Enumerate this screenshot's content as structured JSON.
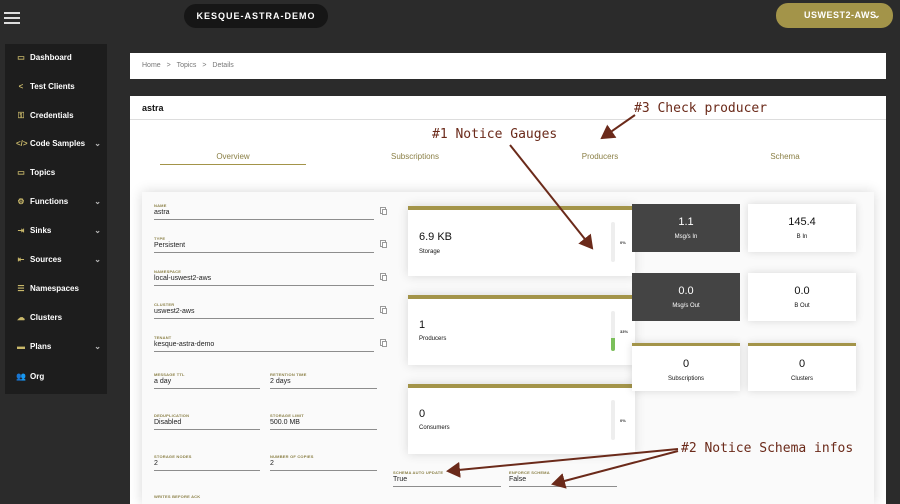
{
  "header": {
    "cluster_name": "KESQUE-ASTRA-DEMO",
    "region": "USWEST2-AWS"
  },
  "sidebar": {
    "items": [
      {
        "label": "Dashboard",
        "icon": "monitor-icon",
        "glyph": "▭",
        "has_chevron": false
      },
      {
        "label": "Test Clients",
        "icon": "share-icon",
        "glyph": "<",
        "has_chevron": false
      },
      {
        "label": "Credentials",
        "icon": "key-icon",
        "glyph": "⚿",
        "has_chevron": false
      },
      {
        "label": "Code Samples",
        "icon": "code-icon",
        "glyph": "</>",
        "has_chevron": true
      },
      {
        "label": "Topics",
        "icon": "folder-icon",
        "glyph": "▭",
        "has_chevron": false
      },
      {
        "label": "Functions",
        "icon": "cogs-icon",
        "glyph": "⚙",
        "has_chevron": true
      },
      {
        "label": "Sinks",
        "icon": "sign-in-icon",
        "glyph": "⇥",
        "has_chevron": true
      },
      {
        "label": "Sources",
        "icon": "sign-out-icon",
        "glyph": "⇤",
        "has_chevron": true
      },
      {
        "label": "Namespaces",
        "icon": "list-icon",
        "glyph": "☰",
        "has_chevron": false
      },
      {
        "label": "Clusters",
        "icon": "cloud-icon",
        "glyph": "☁",
        "has_chevron": false
      },
      {
        "label": "Plans",
        "icon": "card-icon",
        "glyph": "▬",
        "has_chevron": true
      },
      {
        "label": "Org",
        "icon": "users-icon",
        "glyph": "👥",
        "has_chevron": false
      }
    ]
  },
  "breadcrumb": {
    "home": "Home",
    "topics": "Topics",
    "details": "Details",
    "separator": ">"
  },
  "topic": {
    "title": "astra"
  },
  "tabs": [
    {
      "label": "Overview",
      "active": true
    },
    {
      "label": "Subscriptions",
      "active": false
    },
    {
      "label": "Producers",
      "active": false
    },
    {
      "label": "Schema",
      "active": false
    }
  ],
  "fields": {
    "name": {
      "label": "NAME",
      "value": "astra"
    },
    "type": {
      "label": "TYPE",
      "value": "Persistent"
    },
    "namespace": {
      "label": "NAMESPACE",
      "value": "local-uswest2-aws"
    },
    "cluster": {
      "label": "CLUSTER",
      "value": "uswest2-aws"
    },
    "tenant": {
      "label": "TENANT",
      "value": "kesque-astra-demo"
    },
    "message_ttl": {
      "label": "MESSAGE TTL",
      "value": "a day"
    },
    "retention_time": {
      "label": "RETENTION TIME",
      "value": "2 days"
    },
    "deduplication": {
      "label": "DEDUPLICATION",
      "value": "Disabled"
    },
    "storage_limit": {
      "label": "STORAGE LIMIT",
      "value": "500.0 MB"
    },
    "storage_nodes": {
      "label": "STORAGE NODES",
      "value": "2"
    },
    "number_of_copies": {
      "label": "NUMBER OF COPIES",
      "value": "2"
    },
    "writes_before_ack": {
      "label": "WRITES BEFORE ACK",
      "value": ""
    },
    "schema_auto_update": {
      "label": "SCHEMA AUTO UPDATE",
      "value": "True"
    },
    "enforce_schema": {
      "label": "ENFORCE SCHEMA",
      "value": "False"
    }
  },
  "gauges": {
    "storage": {
      "value": "6.9 KB",
      "label": "Storage",
      "percent_text": "0%",
      "fill_fraction": 0.0
    },
    "producers": {
      "value": "1",
      "label": "Producers",
      "percent_text": "33%",
      "fill_fraction": 0.33
    },
    "consumers": {
      "value": "0",
      "label": "Consumers",
      "percent_text": "0%",
      "fill_fraction": 0.0
    }
  },
  "stats": {
    "msgs_in": {
      "value": "1.1",
      "label": "Msg/s In"
    },
    "bytes_in": {
      "value": "145.4",
      "label": "B In"
    },
    "msgs_out": {
      "value": "0.0",
      "label": "Msg/s Out"
    },
    "bytes_out": {
      "value": "0.0",
      "label": "B Out"
    },
    "subscriptions": {
      "value": "0",
      "label": "Subscriptions"
    },
    "clusters": {
      "value": "0",
      "label": "Clusters"
    }
  },
  "annotations": {
    "check_producer": "#3 Check producer",
    "notice_gauges": "#1 Notice Gauges",
    "notice_schema": "#2 Notice Schema infos"
  },
  "colors": {
    "accent": "#a39449",
    "annotation": "#6b2a1a",
    "gauge_fill": "#7bbf5a"
  }
}
